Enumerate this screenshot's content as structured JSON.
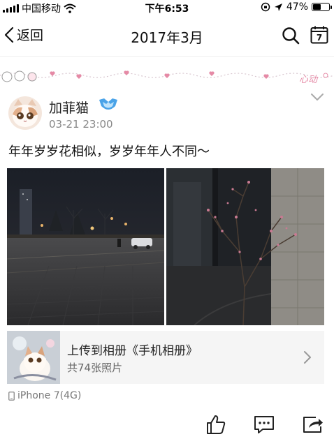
{
  "status_bar": {
    "carrier": "中国移动",
    "time": "下午6:53",
    "battery_percent": "47%",
    "battery_level": 0.47,
    "icons": [
      "signal-icon",
      "wifi-icon",
      "orientation-lock-icon",
      "location-arrow-icon",
      "battery-icon"
    ]
  },
  "nav": {
    "back_label": "返回",
    "title": "2017年3月",
    "calendar_day": "7",
    "icons": [
      "back-chevron-icon",
      "search-icon",
      "calendar-icon"
    ]
  },
  "decoration": {
    "strip_text": "心动"
  },
  "post": {
    "username": "加菲猫",
    "timestamp": "03-21 23:00",
    "text": "年年岁岁花相似，岁岁年年人不同～",
    "photos": [
      "night-plaza-photo",
      "blossom-tree-photo"
    ]
  },
  "album": {
    "title": "上传到相册《手机相册》",
    "count": "共74张照片"
  },
  "device": {
    "label": "iPhone 7(4G)"
  },
  "actions": [
    "like-icon",
    "comment-icon",
    "share-icon"
  ],
  "colors": {
    "text": "#111111",
    "secondary_text": "#888888",
    "card_bg": "#f5f5f5",
    "badge_blue": "#4aa3e8",
    "deco_pink": "#e58aa6"
  }
}
